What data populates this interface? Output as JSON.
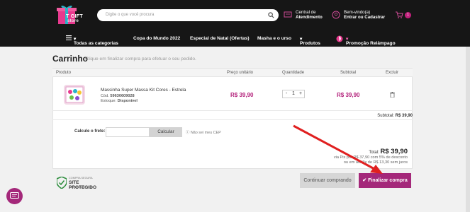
{
  "header": {
    "logo_text": "T GIFT",
    "logo_sub": "store",
    "search_placeholder": "Digite o que você procura",
    "atendimento_line1": "Central de",
    "atendimento_line2": "Atendimento",
    "user_line1": "Bem-vindo(a)",
    "user_line2": "Entrar ou Cadastrar",
    "cart_count": "1"
  },
  "nav": {
    "items": [
      "Todas as categorias",
      "Copa do Mundo 2022",
      "Especial de Natal (Ofertas)",
      "Masha e o urso",
      "Produtos",
      "Promoção Relâmpago"
    ]
  },
  "cart": {
    "title": "Carrinho",
    "subtitle": "Clique em finalizar compra para efetuar o seu pedido.",
    "columns": [
      "Produto",
      "Preço unitário",
      "Quantidade",
      "Subtotal",
      "Excluir"
    ],
    "item": {
      "name": "Massinha Super Massa Kit Cores - Estrela",
      "cod_label": "Cód.",
      "cod": "59630609028",
      "stock_label": "Estoque:",
      "stock": "Disponível",
      "unit_price": "R$ 39,90",
      "qty": "1",
      "subtotal": "R$ 39,90"
    },
    "subtotal_label": "Subtotal:",
    "subtotal_value": "R$ 39,90",
    "frete_label": "Calcule o frete:",
    "calc_button": "Calcular",
    "cep_help": "Não sei meu CEP",
    "total_label": "Total:",
    "total_value": "R$ 39,90",
    "pix_line": "via Pix por R$ 37,90 com 5% de desconto",
    "installments_line": "ou em até 3x de R$ 13,30 sem juros",
    "continue_button": "Continuar comprando",
    "checkout_button": "✔ Finalizar compra"
  },
  "badge": {
    "line1": "COMPRA SEGURA",
    "line2": "SITE PROTEGIDO",
    "line3": "CERTIFICADO SSL"
  },
  "colors": {
    "brand": "#a4287a",
    "price": "#b3207a",
    "arrow": "#e02020"
  }
}
